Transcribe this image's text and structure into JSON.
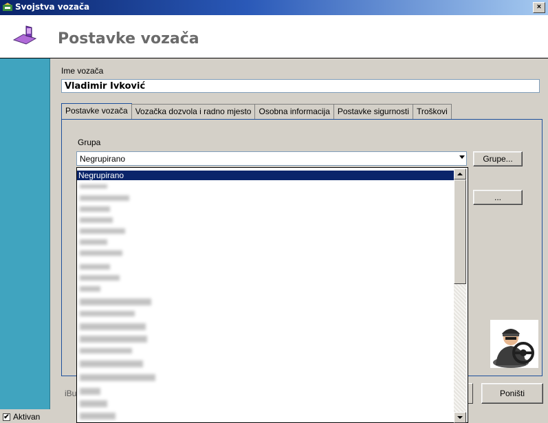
{
  "window": {
    "title": "Svojstva vozača",
    "close_label": "×"
  },
  "header": {
    "title": "Postavke vozača",
    "icon": "driver-settings-icon"
  },
  "driver_name": {
    "label": "Ime vozača",
    "value": "Vladimir Ivković"
  },
  "tabs": [
    {
      "label": "Postavke vozača",
      "active": true
    },
    {
      "label": "Vozačka dozvola i radno mjesto",
      "active": false
    },
    {
      "label": "Osobna informacija",
      "active": false
    },
    {
      "label": "Postavke sigurnosti",
      "active": false
    },
    {
      "label": "Troškovi",
      "active": false
    }
  ],
  "group": {
    "label": "Grupa",
    "selected": "Negrupirano",
    "groups_button": "Grupe...",
    "browse_button": "..."
  },
  "dropdown": {
    "options_visible": [
      "Negrupirano"
    ],
    "redacted_rows": 20
  },
  "footer": {
    "partial_text": "iBu",
    "cancel_button": "Poništi",
    "active_checkbox_label": "Aktivan",
    "active_checked": true,
    "check_mark": "✔"
  }
}
